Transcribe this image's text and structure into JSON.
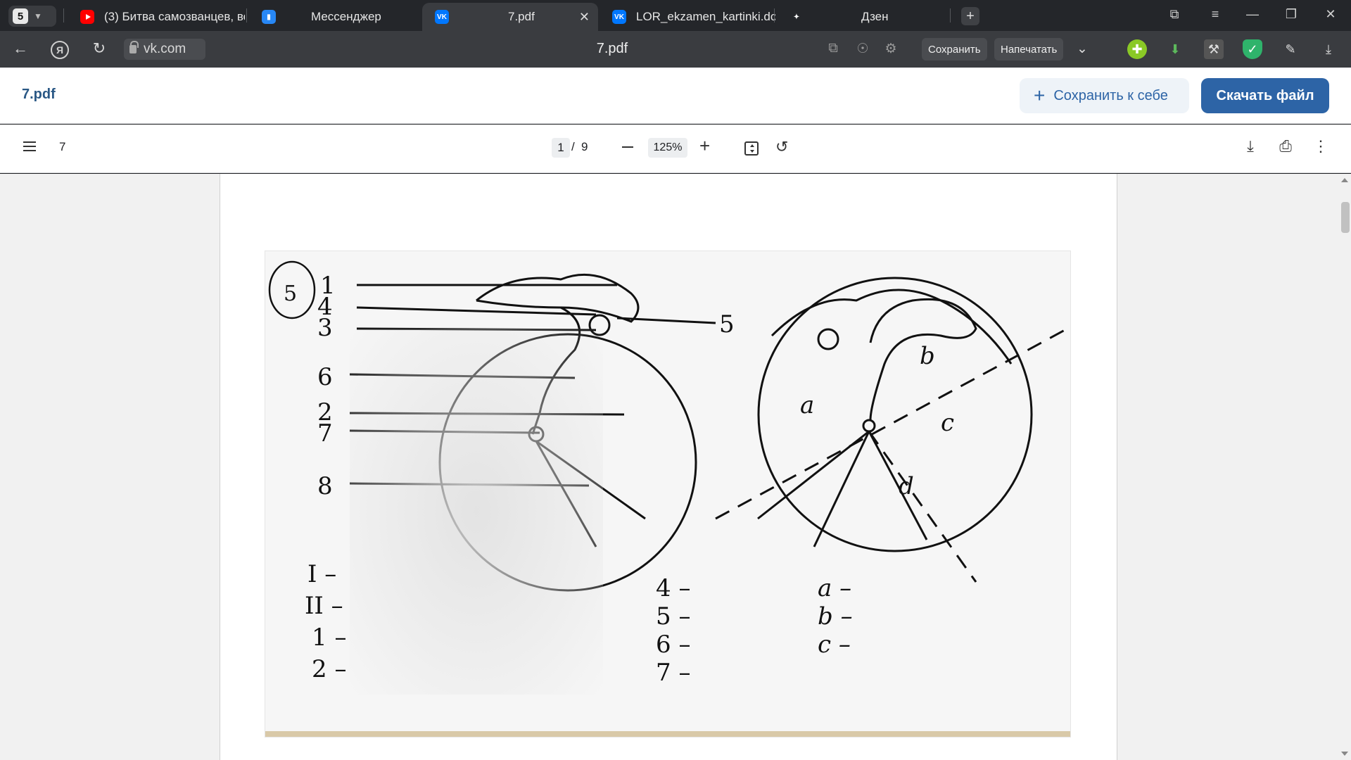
{
  "browser": {
    "tab_count": "5",
    "tabs": [
      {
        "title": "(3) Битва самозванцев, во",
        "favicon": "youtube-icon"
      },
      {
        "title": "Мессенджер",
        "favicon": "vk-messenger-icon"
      },
      {
        "title": "7.pdf",
        "favicon": "vk-icon",
        "active": true
      },
      {
        "title": "LOR_ekzamen_kartinki.doc",
        "favicon": "vk-icon"
      },
      {
        "title": "Дзен",
        "favicon": "dzen-icon"
      }
    ],
    "address": {
      "domain": "vk.com",
      "page_title": "7.pdf",
      "save_button": "Сохранить",
      "print_button": "Напечатать"
    }
  },
  "vk": {
    "filename": "7.pdf",
    "save_to_me": "Сохранить к себе",
    "download": "Скачать файл",
    "accent_color": "#2d64a6"
  },
  "pdf_viewer": {
    "doc_name": "7",
    "current_page": "1",
    "page_separator": "/",
    "total_pages": "9",
    "zoom": "125%"
  },
  "diagram": {
    "circle_number": "5",
    "left_labels": [
      "1",
      "4",
      "3",
      "6",
      "2",
      "7",
      "8"
    ],
    "right_label": "5",
    "quadrant_labels": [
      "a",
      "b",
      "c",
      "d"
    ],
    "legend_roman": [
      "I –",
      "II –"
    ],
    "legend_numbers_left": [
      "1 –",
      "2 –"
    ],
    "legend_numbers_mid": [
      "4 –",
      "5 –",
      "6 –",
      "7 –"
    ],
    "legend_letters": [
      "a –",
      "b –",
      "c –"
    ]
  }
}
